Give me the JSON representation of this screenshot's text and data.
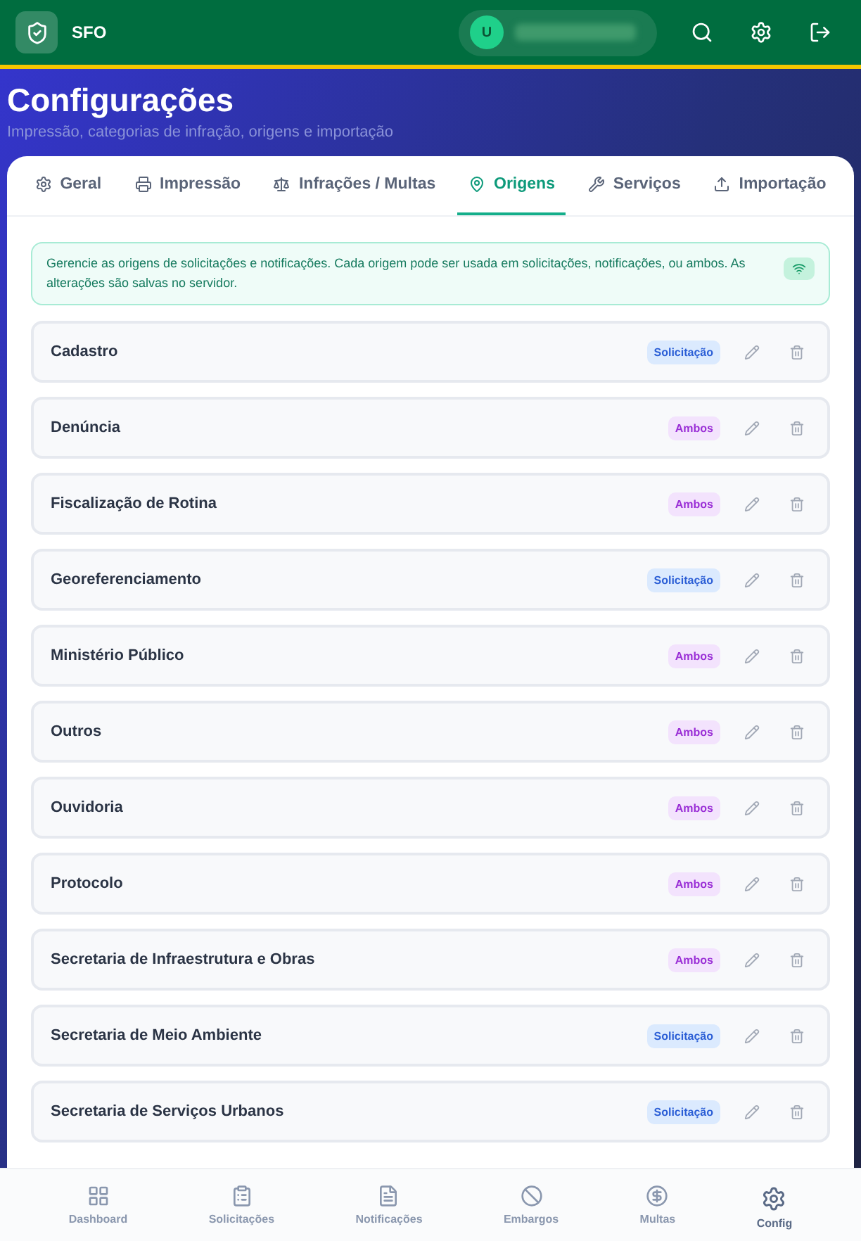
{
  "header": {
    "app_name": "SFO",
    "avatar_initial": "U"
  },
  "page": {
    "title": "Configurações",
    "subtitle": "Impressão, categorias de infração, origens e importação"
  },
  "tabs": [
    {
      "label": "Geral",
      "selected": false
    },
    {
      "label": "Impressão",
      "selected": false
    },
    {
      "label": "Infrações / Multas",
      "selected": false
    },
    {
      "label": "Origens",
      "selected": true
    },
    {
      "label": "Serviços",
      "selected": false
    },
    {
      "label": "Importação",
      "selected": false
    }
  ],
  "info": "Gerencie as origens de solicitações e notificações. Cada origem pode ser usada em solicitações, notificações, ou ambos. As alterações são salvas no servidor.",
  "origins": [
    {
      "name": "Cadastro",
      "tag": "Solicitação",
      "kind": "solicitacao"
    },
    {
      "name": "Denúncia",
      "tag": "Ambos",
      "kind": "ambos"
    },
    {
      "name": "Fiscalização de Rotina",
      "tag": "Ambos",
      "kind": "ambos"
    },
    {
      "name": "Georeferenciamento",
      "tag": "Solicitação",
      "kind": "solicitacao"
    },
    {
      "name": "Ministério Público",
      "tag": "Ambos",
      "kind": "ambos"
    },
    {
      "name": "Outros",
      "tag": "Ambos",
      "kind": "ambos"
    },
    {
      "name": "Ouvidoria",
      "tag": "Ambos",
      "kind": "ambos"
    },
    {
      "name": "Protocolo",
      "tag": "Ambos",
      "kind": "ambos"
    },
    {
      "name": "Secretaria de Infraestrutura e Obras",
      "tag": "Ambos",
      "kind": "ambos"
    },
    {
      "name": "Secretaria de Meio Ambiente",
      "tag": "Solicitação",
      "kind": "solicitacao"
    },
    {
      "name": "Secretaria de Serviços Urbanos",
      "tag": "Solicitação",
      "kind": "solicitacao"
    }
  ],
  "bottom_nav": [
    {
      "label": "Dashboard",
      "selected": false
    },
    {
      "label": "Solicitações",
      "selected": false
    },
    {
      "label": "Notificações",
      "selected": false
    },
    {
      "label": "Embargos",
      "selected": false
    },
    {
      "label": "Multas",
      "selected": false
    },
    {
      "label": "Config",
      "selected": true
    }
  ]
}
